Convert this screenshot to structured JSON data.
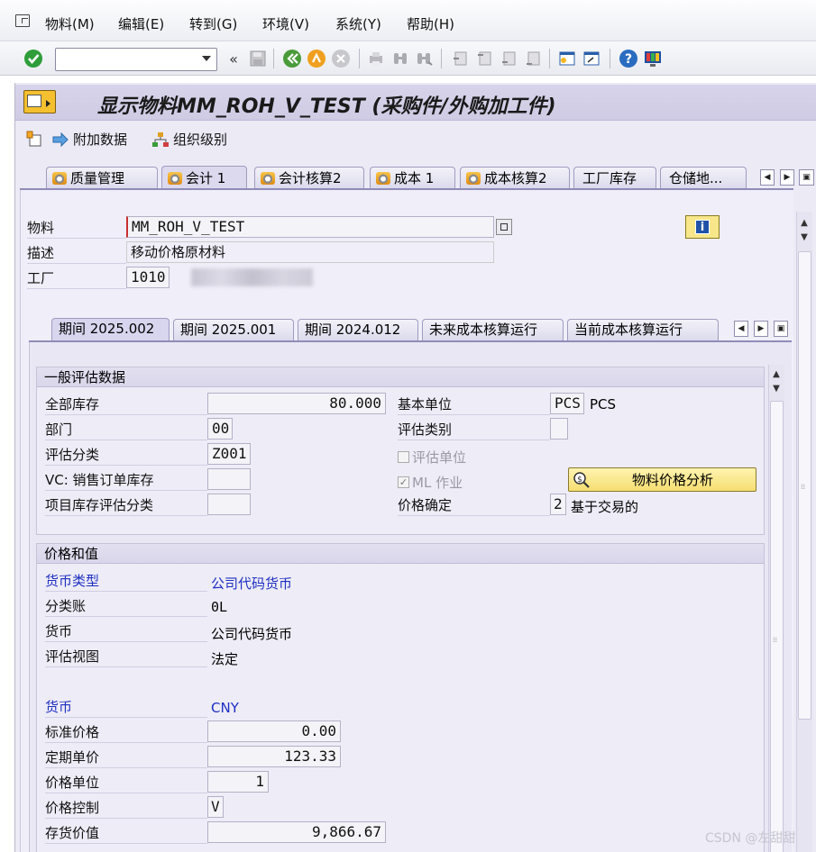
{
  "menu": {
    "items": [
      {
        "label": "物料(M)"
      },
      {
        "label": "编辑(E)"
      },
      {
        "label": "转到(G)"
      },
      {
        "label": "环境(V)"
      },
      {
        "label": "系统(Y)"
      },
      {
        "label": "帮助(H)"
      }
    ]
  },
  "toolbar": {
    "command_field_value": ""
  },
  "header": {
    "title": "显示物料MM_ROH_V_TEST (采购件/外购加工件)"
  },
  "app_toolbar": {
    "additional_data": "附加数据",
    "org_levels": "组织级别"
  },
  "tabs": [
    {
      "label": "质量管理"
    },
    {
      "label": "会计 1"
    },
    {
      "label": "会计核算2"
    },
    {
      "label": "成本 1"
    },
    {
      "label": "成本核算2"
    },
    {
      "label": "工厂库存"
    },
    {
      "label": "仓储地..."
    }
  ],
  "material": {
    "material_label": "物料",
    "material_value": "MM_ROH_V_TEST",
    "desc_label": "描述",
    "desc_value": "移动价格原材料",
    "plant_label": "工厂",
    "plant_value": "1010"
  },
  "period_tabs": [
    {
      "label": "期间 2025.002"
    },
    {
      "label": "期间 2025.001"
    },
    {
      "label": "期间 2024.012"
    },
    {
      "label": "未来成本核算运行"
    },
    {
      "label": "当前成本核算运行"
    }
  ],
  "general": {
    "title": "一般评估数据",
    "total_stock_label": "全部库存",
    "total_stock": "80.000",
    "division_label": "部门",
    "division": "00",
    "val_class_label": "评估分类",
    "val_class": "Z001",
    "vc_label": "VC: 销售订单库存",
    "vc": "",
    "proj_label": "项目库存评估分类",
    "proj": "",
    "base_unit_label": "基本单位",
    "base_unit": "PCS",
    "base_unit_text": "PCS",
    "val_cat_label": "评估类别",
    "val_cat": "",
    "val_unit_label": "评估单位",
    "ml_label": "ML 作业",
    "price_analysis_label": "物料价格分析",
    "price_det_label": "价格确定",
    "price_det": "2",
    "price_det_text": "基于交易的"
  },
  "prices": {
    "title": "价格和值",
    "currency_type_label": "货币类型",
    "currency_type": "公司代码货币",
    "ledger_label": "分类账",
    "ledger": "0L",
    "currency_label": "货币",
    "currency": "公司代码货币",
    "view_label": "评估视图",
    "view": "法定",
    "currency2_label": "货币",
    "currency2": "CNY",
    "std_price_label": "标准价格",
    "std_price": "0.00",
    "per_price_label": "定期单价",
    "per_price": "123.33",
    "price_unit_label": "价格单位",
    "price_unit": "1",
    "price_ctrl_label": "价格控制",
    "price_ctrl": "V",
    "inv_value_label": "存货价值",
    "inv_value": "9,866.67"
  },
  "watermark": "CSDN @左甜甜",
  "colors": {
    "accent_blue": "#1e2fc2",
    "ok_green": "#2e9d3a",
    "app_bg": "#eceaf5"
  }
}
